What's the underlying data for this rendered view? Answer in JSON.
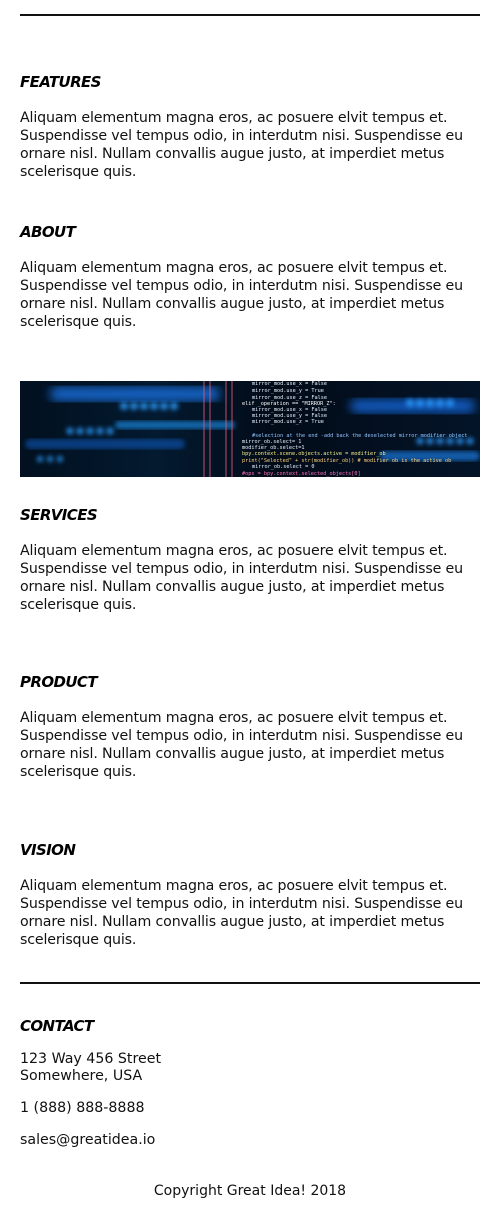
{
  "sections": [
    {
      "heading": "Features",
      "text": "Aliquam elementum magna eros, ac posuere elvit tempus et. Suspendisse vel tempus odio, in interdutm nisi. Suspendisse eu ornare nisl. Nullam convallis augue justo, at imperdiet metus scelerisque quis."
    },
    {
      "heading": "About",
      "text": "Aliquam elementum magna eros, ac posuere elvit tempus et. Suspendisse vel tempus odio, in interdutm nisi. Suspendisse eu ornare nisl. Nullam convallis augue justo, at imperdiet metus scelerisque quis."
    },
    {
      "heading": "Services",
      "text": "Aliquam elementum magna eros, ac posuere elvit tempus et. Suspendisse vel tempus odio, in interdutm nisi. Suspendisse eu ornare nisl. Nullam convallis augue justo, at imperdiet metus scelerisque quis."
    },
    {
      "heading": "Product",
      "text": "Aliquam elementum magna eros, ac posuere elvit tempus et. Suspendisse vel tempus odio, in interdutm nisi. Suspendisse eu ornare nisl. Nullam convallis augue justo, at imperdiet metus scelerisque quis."
    },
    {
      "heading": "Vision",
      "text": "Aliquam elementum magna eros, ac posuere elvit tempus et. Suspendisse vel tempus odio, in interdutm nisi. Suspendisse eu ornare nisl. Nullam convallis augue justo, at imperdiet metus scelerisque quis."
    }
  ],
  "banner": {
    "icon": "code-screen-image",
    "code_lines": [
      "mirror_mod.use_x = False",
      "mirror_mod.use_y = True",
      "mirror_mod.use_z = False",
      "elif _operation == \"MIRROR_Z\":",
      "mirror_mod.use_x = False",
      "mirror_mod.use_y = False",
      "mirror_mod.use_z = True",
      "#selection at the end -add back the deselected mirror modifier object",
      "mirror_ob.select= 1",
      "modifier_ob.select=1",
      "bpy.context.scene.objects.active = modifier_ob",
      "print(\"Selected\" + str(modifier_ob)) # modifier ob is the active ob",
      "mirror_ob.select = 0",
      "#ops = bpy.context.selected_objects[0]"
    ]
  },
  "contact": {
    "heading": "Contact",
    "address_line1": "123 Way 456 Street",
    "address_line2": "Somewhere, USA",
    "phone": "1 (888) 888-8888",
    "email": "sales@greatidea.io"
  },
  "footer": {
    "copyright": "Copyright Great Idea! 2018"
  },
  "colors": {
    "text": "#111111",
    "rule": "#111111",
    "banner_bg": "#031a30",
    "banner_accent": "#1e90ff"
  }
}
